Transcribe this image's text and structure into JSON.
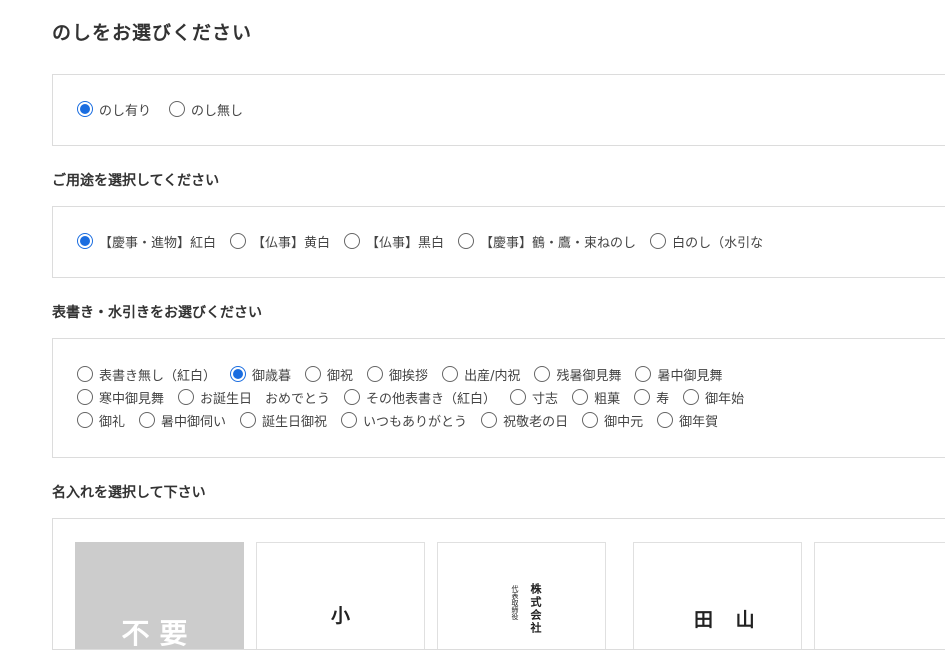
{
  "page_title": "のしをお選びください",
  "noshi": {
    "options": [
      {
        "label": "のし有り",
        "selected": true
      },
      {
        "label": "のし無し",
        "selected": false
      }
    ]
  },
  "usage": {
    "label": "ご用途を選択してください",
    "options": [
      {
        "label": "【慶事・進物】紅白",
        "selected": true
      },
      {
        "label": "【仏事】黄白",
        "selected": false
      },
      {
        "label": "【仏事】黒白",
        "selected": false
      },
      {
        "label": "【慶事】鶴・鷹・束ねのし",
        "selected": false
      },
      {
        "label": "白のし（水引な",
        "selected": false
      }
    ]
  },
  "omotegaki": {
    "label": "表書き・水引きをお選びください",
    "rows": [
      [
        {
          "label": "表書き無し（紅白）",
          "selected": false
        },
        {
          "label": "御歳暮",
          "selected": true
        },
        {
          "label": "御祝",
          "selected": false
        },
        {
          "label": "御挨拶",
          "selected": false
        },
        {
          "label": "出産/内祝",
          "selected": false
        },
        {
          "label": "残暑御見舞",
          "selected": false
        },
        {
          "label": "暑中御見舞",
          "selected": false
        }
      ],
      [
        {
          "label": "寒中御見舞",
          "selected": false
        },
        {
          "label": "お誕生日　おめでとう",
          "selected": false
        },
        {
          "label": "その他表書き（紅白）",
          "selected": false
        },
        {
          "label": "寸志",
          "selected": false
        },
        {
          "label": "粗菓",
          "selected": false
        },
        {
          "label": "寿",
          "selected": false
        },
        {
          "label": "御年始",
          "selected": false
        }
      ],
      [
        {
          "label": "御礼",
          "selected": false
        },
        {
          "label": "暑中御伺い",
          "selected": false
        },
        {
          "label": "誕生日御祝",
          "selected": false
        },
        {
          "label": "いつもありがとう",
          "selected": false
        },
        {
          "label": "祝敬老の日",
          "selected": false
        },
        {
          "label": "御中元",
          "selected": false
        },
        {
          "label": "御年賀",
          "selected": false
        }
      ]
    ]
  },
  "naire": {
    "label": "名入れを選択して下さい",
    "cards": [
      {
        "text": "不要"
      },
      {
        "text": "小"
      },
      {
        "company": "株式会社",
        "title": "代表取締役"
      },
      {
        "text": "田 山"
      },
      {
        "text": ""
      }
    ]
  }
}
